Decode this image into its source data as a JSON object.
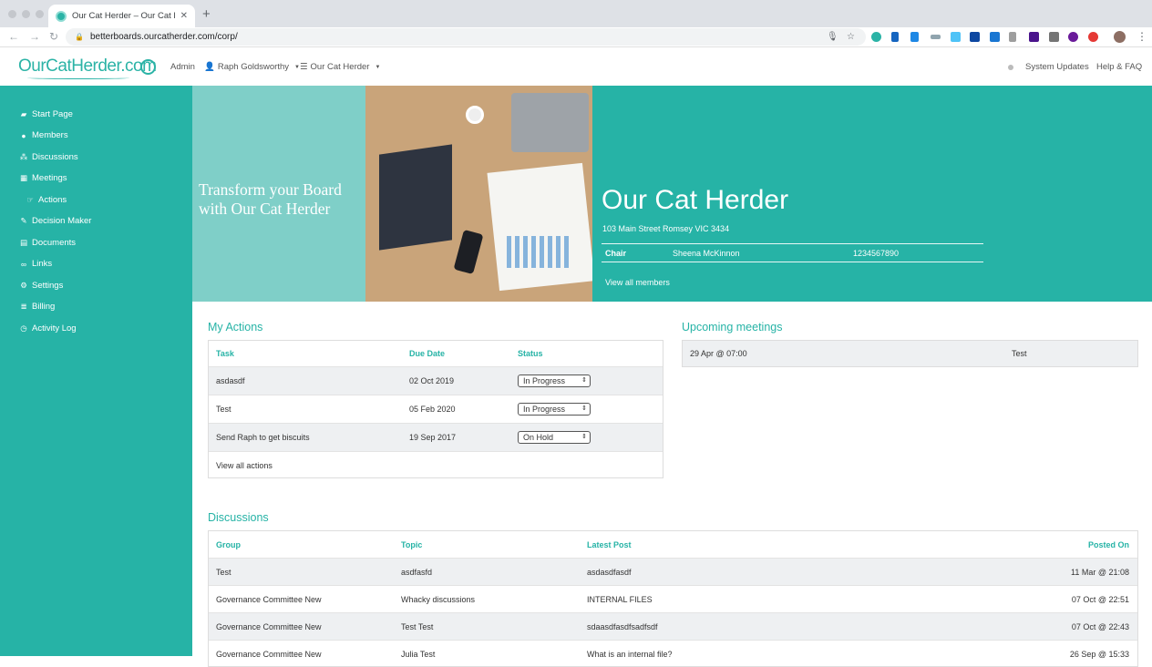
{
  "browser": {
    "tab_title": "Our Cat Herder – Our Cat Herd",
    "url": "betterboards.ourcatherder.com/corp/"
  },
  "header": {
    "logo_text": "OurCatHerder.com",
    "admin": "Admin",
    "user": "Raph Goldsworthy",
    "org_menu": "Our Cat Herder",
    "system_updates": "System Updates",
    "help": "Help & FAQ"
  },
  "sidebar": {
    "items": [
      {
        "label": "Start Page",
        "icon": "dashboard-icon"
      },
      {
        "label": "Members",
        "icon": "user-icon"
      },
      {
        "label": "Discussions",
        "icon": "users-icon"
      },
      {
        "label": "Meetings",
        "icon": "calendar-icon"
      },
      {
        "label": "Actions",
        "icon": "hand-point-icon"
      },
      {
        "label": "Decision Maker",
        "icon": "pencil-icon"
      },
      {
        "label": "Documents",
        "icon": "file-icon"
      },
      {
        "label": "Links",
        "icon": "link-icon"
      },
      {
        "label": "Settings",
        "icon": "gears-icon"
      },
      {
        "label": "Billing",
        "icon": "list-icon"
      },
      {
        "label": "Activity Log",
        "icon": "clock-icon"
      }
    ]
  },
  "banner": {
    "tagline": "Transform your Board with Our Cat Herder",
    "org_name": "Our Cat Herder",
    "address": "103 Main Street Romsey VIC 3434",
    "chair_label": "Chair",
    "chair_name": "Sheena McKinnon",
    "chair_phone": "1234567890",
    "view_members": "View all members"
  },
  "my_actions": {
    "title": "My Actions",
    "headers": [
      "Task",
      "Due Date",
      "Status"
    ],
    "rows": [
      {
        "task": "asdasdf",
        "due": "02 Oct 2019",
        "status": "In Progress"
      },
      {
        "task": "Test",
        "due": "05 Feb 2020",
        "status": "In Progress"
      },
      {
        "task": "Send Raph to get biscuits",
        "due": "19 Sep 2017",
        "status": "On Hold"
      }
    ],
    "view_all": "View all actions"
  },
  "upcoming": {
    "title": "Upcoming meetings",
    "rows": [
      {
        "when": "29 Apr @ 07:00",
        "name": "Test"
      }
    ]
  },
  "discussions": {
    "title": "Discussions",
    "headers": [
      "Group",
      "Topic",
      "Latest Post",
      "Posted On"
    ],
    "rows": [
      {
        "group": "Test",
        "topic": "asdfasfd",
        "post": "asdasdfasdf",
        "posted": "11 Mar @ 21:08"
      },
      {
        "group": "Governance Committee New",
        "topic": "Whacky discussions",
        "post": "INTERNAL FILES",
        "posted": "07 Oct @ 22:51"
      },
      {
        "group": "Governance Committee New",
        "topic": "Test Test",
        "post": "sdaasdfasdfsadfsdf",
        "posted": "07 Oct @ 22:43"
      },
      {
        "group": "Governance Committee New",
        "topic": "Julia Test",
        "post": "What is an internal file?",
        "posted": "26 Sep @ 15:33"
      }
    ]
  },
  "colors": {
    "accent": "#26b3a6",
    "row_alt": "#eef0f2"
  }
}
